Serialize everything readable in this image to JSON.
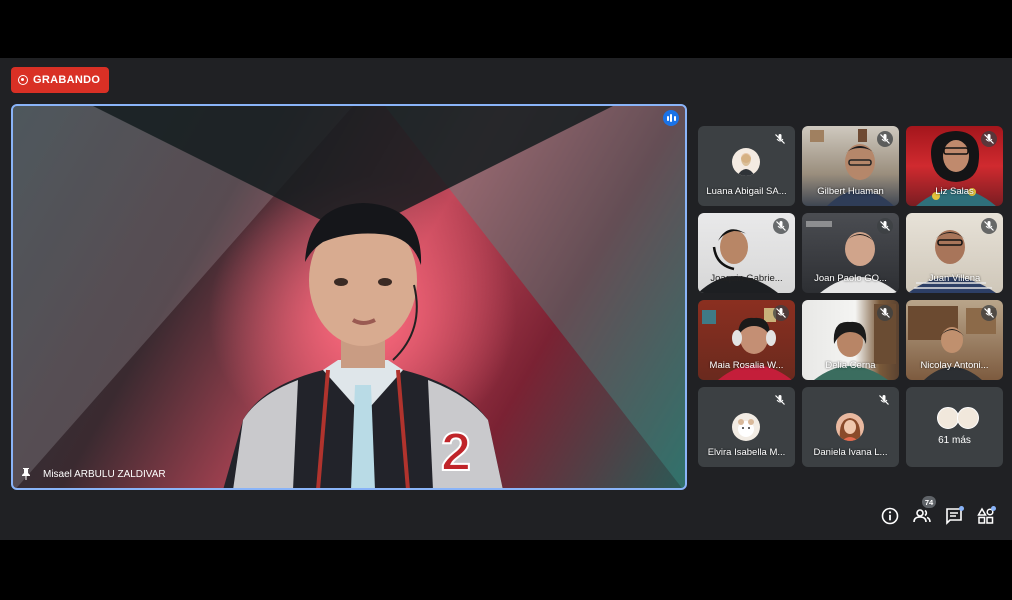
{
  "recording": {
    "label": "GRABANDO",
    "color": "#d93025"
  },
  "main_speaker": {
    "name": "Misael ARBULU ZALDIVAR",
    "speaking": true
  },
  "participants": [
    {
      "name": "Luana Abigail SA...",
      "muted": true,
      "camera": false
    },
    {
      "name": "Gilbert Huaman",
      "muted": true,
      "camera": true
    },
    {
      "name": "Liz Salas",
      "muted": true,
      "camera": true
    },
    {
      "name": "Joaquin Gabrie...",
      "muted": true,
      "camera": true
    },
    {
      "name": "Joan Paolo GO...",
      "muted": true,
      "camera": true
    },
    {
      "name": "Juan Villena",
      "muted": true,
      "camera": true
    },
    {
      "name": "Maia Rosalia W...",
      "muted": true,
      "camera": true
    },
    {
      "name": "Delia Cerna",
      "muted": true,
      "camera": true
    },
    {
      "name": "Nicolay Antoni...",
      "muted": true,
      "camera": true
    },
    {
      "name": "Elvira Isabella M...",
      "muted": true,
      "camera": false
    },
    {
      "name": "Daniela Ivana L...",
      "muted": true,
      "camera": false
    }
  ],
  "more": {
    "label": "61 más"
  },
  "controls": {
    "info": "info-icon",
    "people": {
      "icon": "people-icon",
      "count": "74"
    },
    "chat": "chat-icon",
    "activities": "activities-icon"
  }
}
